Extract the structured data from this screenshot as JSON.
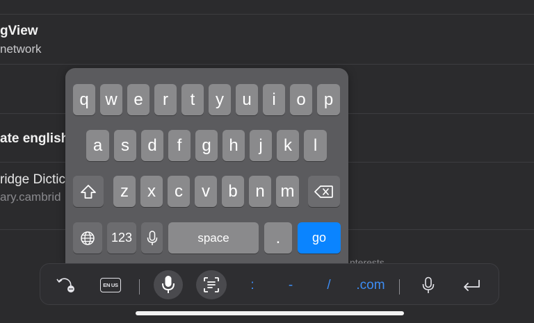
{
  "background_list": {
    "row1_title": "gView",
    "row1_subtitle": "network",
    "row2_title": "ate english",
    "row3_title": "ridge Dictic",
    "row3_subtitle": "ary.cambrid",
    "partial_text": "nterests"
  },
  "keyboard": {
    "row1": [
      "q",
      "w",
      "e",
      "r",
      "t",
      "y",
      "u",
      "i",
      "o",
      "p"
    ],
    "row2": [
      "a",
      "s",
      "d",
      "f",
      "g",
      "h",
      "j",
      "k",
      "l"
    ],
    "row3": [
      "z",
      "x",
      "c",
      "v",
      "b",
      "n",
      "m"
    ],
    "numbers_label": "123",
    "space_label": "space",
    "period_label": ".",
    "go_label": "go",
    "icons": {
      "shift": "shift-icon",
      "delete": "delete-icon",
      "globe": "globe-icon",
      "dictation": "microphone-icon"
    }
  },
  "accessory_bar": {
    "language_badge": "EN US",
    "colon": ":",
    "dash": "-",
    "slash": "/",
    "dotcom": ".com",
    "icons": [
      "undo-icon",
      "language-icon",
      "microphone-icon",
      "scan-text-icon",
      "microphone-icon",
      "return-icon"
    ]
  },
  "colors": {
    "accent": "#0a84ff",
    "key": "#8a8a8c",
    "function_key": "#6c6c6f",
    "keyboard_bg": "#5b5b5e",
    "page_bg": "#2b2b2d"
  }
}
